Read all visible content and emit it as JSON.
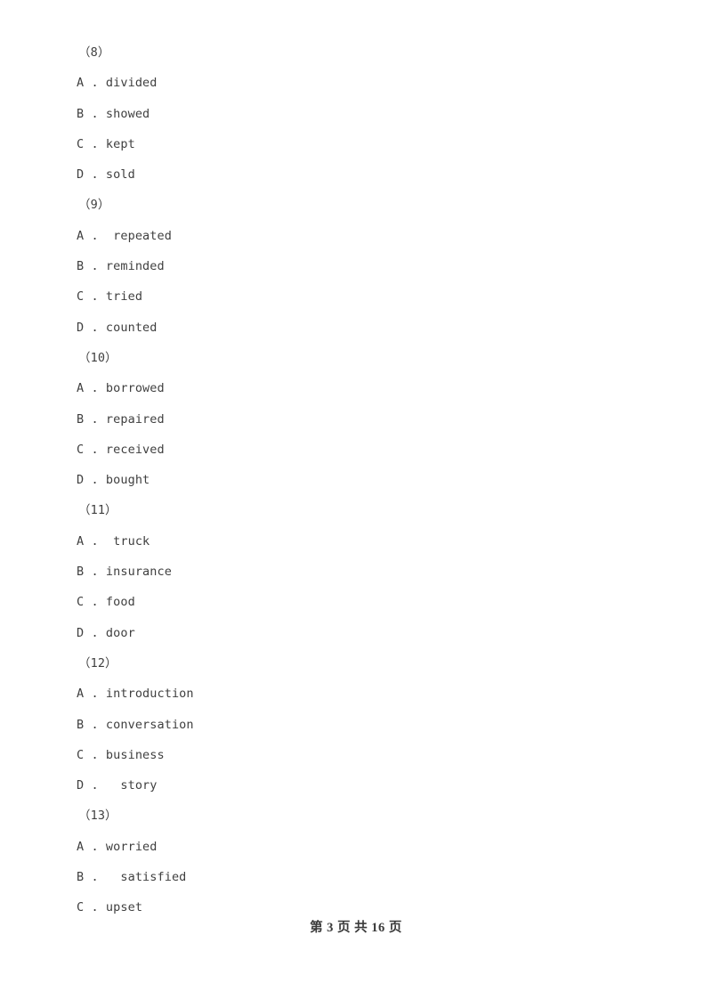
{
  "document": {
    "type": "exam-paper-page",
    "page_number": 3,
    "total_pages": 16,
    "footer_text": "第 3 页 共 16 页",
    "background_color": "#ffffff",
    "text_color": "#3f3f3f"
  },
  "questions": [
    {
      "number": "（8）",
      "options": [
        {
          "letter": "A",
          "text": "A . divided"
        },
        {
          "letter": "B",
          "text": "B . showed"
        },
        {
          "letter": "C",
          "text": "C . kept"
        },
        {
          "letter": "D",
          "text": "D . sold"
        }
      ]
    },
    {
      "number": "（9）",
      "options": [
        {
          "letter": "A",
          "text": "A .  repeated"
        },
        {
          "letter": "B",
          "text": "B . reminded"
        },
        {
          "letter": "C",
          "text": "C . tried"
        },
        {
          "letter": "D",
          "text": "D . counted"
        }
      ]
    },
    {
      "number": "（10）",
      "options": [
        {
          "letter": "A",
          "text": "A . borrowed"
        },
        {
          "letter": "B",
          "text": "B . repaired"
        },
        {
          "letter": "C",
          "text": "C . received"
        },
        {
          "letter": "D",
          "text": "D . bought"
        }
      ]
    },
    {
      "number": "（11）",
      "options": [
        {
          "letter": "A",
          "text": "A .  truck"
        },
        {
          "letter": "B",
          "text": "B . insurance"
        },
        {
          "letter": "C",
          "text": "C . food"
        },
        {
          "letter": "D",
          "text": "D . door"
        }
      ]
    },
    {
      "number": "（12）",
      "options": [
        {
          "letter": "A",
          "text": "A . introduction"
        },
        {
          "letter": "B",
          "text": "B . conversation"
        },
        {
          "letter": "C",
          "text": "C . business"
        },
        {
          "letter": "D",
          "text": "D .   story"
        }
      ]
    },
    {
      "number": "（13）",
      "options": [
        {
          "letter": "A",
          "text": "A . worried"
        },
        {
          "letter": "B",
          "text": "B .   satisfied"
        },
        {
          "letter": "C",
          "text": "C . upset"
        }
      ]
    }
  ]
}
